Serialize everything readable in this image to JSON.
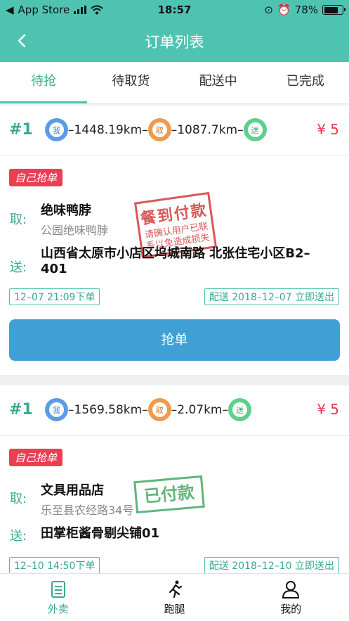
{
  "status_bar": {
    "back_app": "App Store",
    "time": "18:57",
    "battery": "78%"
  },
  "nav": {
    "title": "订单列表"
  },
  "tabs": [
    {
      "label": "待抢"
    },
    {
      "label": "待取货"
    },
    {
      "label": "配送中"
    },
    {
      "label": "已完成"
    }
  ],
  "badges": {
    "me": "我",
    "pickup": "取",
    "deliver": "送"
  },
  "labels": {
    "pickup": "取:",
    "deliver": "送:",
    "grab": "抢单"
  },
  "orders": [
    {
      "num": "#1",
      "dist_to_pickup": "–1448.19km–",
      "dist_to_dest": "–1087.7km–",
      "price": "¥ 5",
      "tag": "自己抢单",
      "shop": "绝味鸭脖",
      "shop_addr": "公园绝味鸭脖",
      "dest": "山西省太原市小店区坞城南路 北张住宅小区B2–401",
      "order_time": "12–07 21:09下单",
      "delivery": "配送 2018–12–07 立即送出",
      "stamp_title": "餐到付款",
      "stamp_text": "请确认用户已联系以免造成损失"
    },
    {
      "num": "#1",
      "dist_to_pickup": "–1569.58km–",
      "dist_to_dest": "–2.07km–",
      "price": "¥ 5",
      "tag": "自己抢单",
      "shop": "文具用品店",
      "shop_addr": "乐至县农经路34号",
      "dest": "田掌柜酱骨剔尖铺01",
      "order_time": "12–10 14:50下单",
      "delivery": "配送 2018–12–10 立即送出",
      "stamp_title": "已付款"
    }
  ],
  "bottom_nav": [
    {
      "label": "外卖"
    },
    {
      "label": "跑腿"
    },
    {
      "label": "我的"
    }
  ],
  "colors": {
    "primary": "#4fc3b2",
    "accent_text": "#3aa88f",
    "price": "#e5384c",
    "button": "#3fa0d6",
    "tag": "#ea3f52"
  }
}
